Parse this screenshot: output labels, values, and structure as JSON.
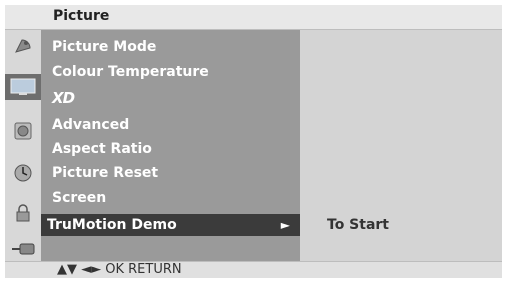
{
  "title": "Picture",
  "menu": {
    "items": [
      {
        "label": "Picture Mode"
      },
      {
        "label": "Colour Temperature"
      },
      {
        "label": "XD"
      },
      {
        "label": "Advanced"
      },
      {
        "label": "Aspect Ratio"
      },
      {
        "label": "Picture Reset"
      },
      {
        "label": "Screen"
      },
      {
        "label": "TruMotion Demo",
        "arrow": "►"
      }
    ]
  },
  "submenu": {
    "option": "To Start"
  },
  "footer": {
    "hint": "▲▼  ◄►  OK  RETURN"
  },
  "icons": [
    "satellite-dish-icon",
    "tv-picture-icon",
    "speaker-icon",
    "clock-icon",
    "lock-icon",
    "input-icon"
  ]
}
